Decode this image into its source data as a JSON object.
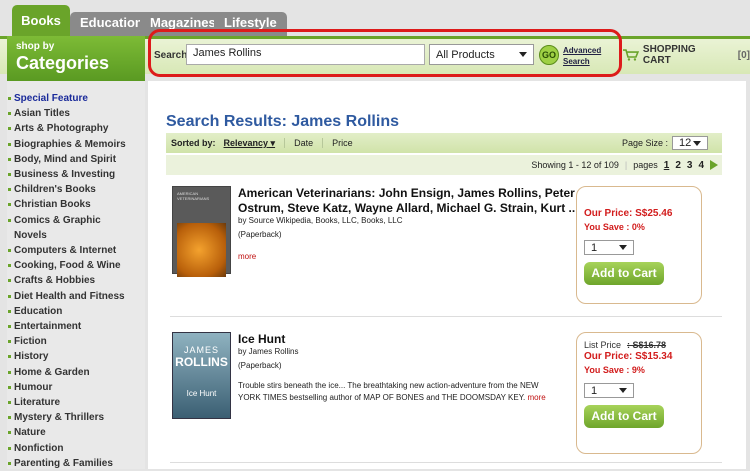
{
  "tabs": [
    {
      "label": "Books"
    },
    {
      "label": "Education"
    },
    {
      "label": "Magazines"
    },
    {
      "label": "Lifestyle"
    }
  ],
  "categories_header": {
    "small": "shop by",
    "big": "Categories"
  },
  "search": {
    "label": "Search",
    "value": "James Rollins",
    "product_filter": "All Products",
    "go_label": "GO",
    "advanced_line1": "Advanced",
    "advanced_line2": "Search"
  },
  "cart": {
    "label": "SHOPPING CART",
    "count": "[0]"
  },
  "sidebar": {
    "items": [
      "Special Feature",
      "Asian Titles",
      "Arts & Photography",
      "Biographies & Memoirs",
      "Body, Mind and Spirit",
      "Business & Investing",
      "Children's Books",
      "Christian Books",
      "Comics & Graphic Novels",
      "Computers & Internet",
      "Cooking, Food & Wine",
      "Crafts & Hobbies",
      "Diet Health and Fitness",
      "Education",
      "Entertainment",
      "Fiction",
      "History",
      "Home & Garden",
      "Humour",
      "Literature",
      "Mystery & Thrillers",
      "Nature",
      "Nonfiction",
      "Parenting & Families"
    ]
  },
  "results": {
    "title": "Search Results: James Rollins",
    "sorted_by_label": "Sorted by:",
    "sort_options": [
      "Relevancy",
      "Date",
      "Price"
    ],
    "page_size_label": "Page Size :",
    "page_size": "12",
    "showing": "Showing 1 - 12 of 109",
    "pages_label": "pages",
    "pages": [
      "1",
      "2",
      "3",
      "4"
    ]
  },
  "products": [
    {
      "title_line1": "American Veterinarians: John Ensign, James Rollins, Peter",
      "title_line2": "Ostrum, Steve Katz, Wayne Allard, Michael G. Strain, Kurt ...",
      "byline": "by Source Wikipedia, Books, LLC, Books, LLC",
      "format": "(Paperback)",
      "more": "more",
      "cover_caption": "AMERICAN VETERINARIANS",
      "our_price": "Our Price: S$25.46",
      "you_save": "You Save : 0%",
      "qty": "1",
      "add_label": "Add to Cart"
    },
    {
      "title_line1": "Ice Hunt",
      "byline": "by James Rollins",
      "format": "(Paperback)",
      "desc_line1": "Trouble stirs beneath the ice... The breathtaking new action-adventure from the NEW",
      "desc_line2": "YORK TIMES bestselling author of MAP OF BONES and THE DOOMSDAY KEY.",
      "more": "more",
      "cover_author": "JAMES",
      "cover_author2": "ROLLINS",
      "cover_title": "Ice Hunt",
      "list_price_label": "List Price",
      "list_price": ": S$16.78",
      "our_price": "Our Price: S$15.34",
      "you_save": "You Save : 9%",
      "qty": "1",
      "add_label": "Add to Cart"
    }
  ]
}
